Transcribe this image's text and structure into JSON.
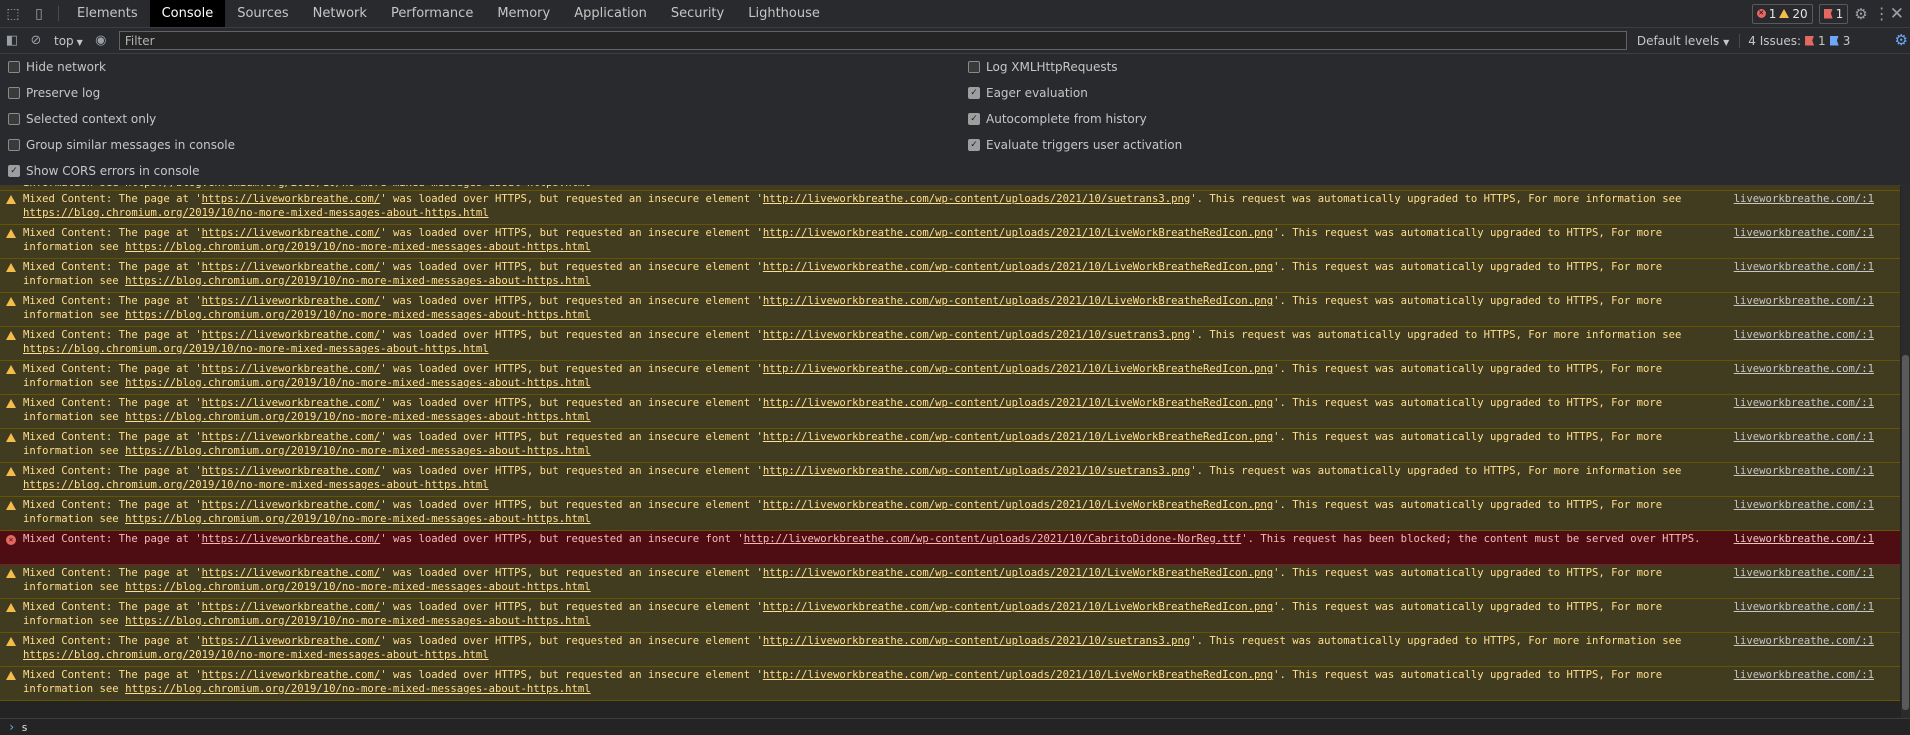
{
  "tabs": [
    "Elements",
    "Console",
    "Sources",
    "Network",
    "Performance",
    "Memory",
    "Application",
    "Security",
    "Lighthouse"
  ],
  "active_tab": "Console",
  "counters": {
    "errors": "1",
    "warnings": "20",
    "issues": "1"
  },
  "toolbar": {
    "context": "top",
    "filter_placeholder": "Filter",
    "levels": "Default levels",
    "issues_label": "4 Issues:",
    "issues_red": "1",
    "issues_blue": "3"
  },
  "settings_left": [
    {
      "label": "Hide network",
      "checked": false
    },
    {
      "label": "Preserve log",
      "checked": false
    },
    {
      "label": "Selected context only",
      "checked": false
    },
    {
      "label": "Group similar messages in console",
      "checked": false
    },
    {
      "label": "Show CORS errors in console",
      "checked": true
    }
  ],
  "settings_right": [
    {
      "label": "Log XMLHttpRequests",
      "checked": false
    },
    {
      "label": "Eager evaluation",
      "checked": true
    },
    {
      "label": "Autocomplete from history",
      "checked": true
    },
    {
      "label": "Evaluate triggers user activation",
      "checked": true
    }
  ],
  "partial_line": "information see https://blog.chromium.org/2019/10/no-more-mixed-messages-about-https.html",
  "messages": [
    {
      "level": "warning",
      "file": "suetrans3.png"
    },
    {
      "level": "warning",
      "file": "LiveWorkBreatheRedIcon.png"
    },
    {
      "level": "warning",
      "file": "LiveWorkBreatheRedIcon.png"
    },
    {
      "level": "warning",
      "file": "LiveWorkBreatheRedIcon.png"
    },
    {
      "level": "warning",
      "file": "suetrans3.png"
    },
    {
      "level": "warning",
      "file": "LiveWorkBreatheRedIcon.png"
    },
    {
      "level": "warning",
      "file": "LiveWorkBreatheRedIcon.png"
    },
    {
      "level": "warning",
      "file": "LiveWorkBreatheRedIcon.png"
    },
    {
      "level": "warning",
      "file": "suetrans3.png"
    },
    {
      "level": "warning",
      "file": "LiveWorkBreatheRedIcon.png"
    },
    {
      "level": "error",
      "file": "CabritoDidone-NorReg.ttf"
    },
    {
      "level": "warning",
      "file": "LiveWorkBreatheRedIcon.png"
    },
    {
      "level": "warning",
      "file": "LiveWorkBreatheRedIcon.png"
    },
    {
      "level": "warning",
      "file": "suetrans3.png"
    },
    {
      "level": "warning",
      "file": "LiveWorkBreatheRedIcon.png"
    }
  ],
  "msg_text": {
    "prefix": "Mixed Content: The page at '",
    "page_url": "https://liveworkbreathe.com/",
    "mid_warning": "' was loaded over HTTPS, but requested an insecure element '",
    "mid_error": "' was loaded over HTTPS, but requested an insecure font '",
    "url_base": "http://liveworkbreathe.com/wp-content/uploads/2021/10/",
    "tail_warning": "'. This request was automatically upgraded to HTTPS, For more information see ",
    "tail_error": "'. This request has been blocked; the content must be served over HTTPS.",
    "blog_url": "https://blog.chromium.org/2019/10/no-more-mixed-messages-about-https.html",
    "source": "liveworkbreathe.com/:1"
  },
  "prompt_text": "s",
  "icons": {
    "inspect": "inspect-element-icon",
    "device": "device-toolbar-icon",
    "sidebar": "sidebar-toggle-icon",
    "clear": "clear-console-icon",
    "eye": "eye-icon",
    "settings": "gear-icon"
  }
}
